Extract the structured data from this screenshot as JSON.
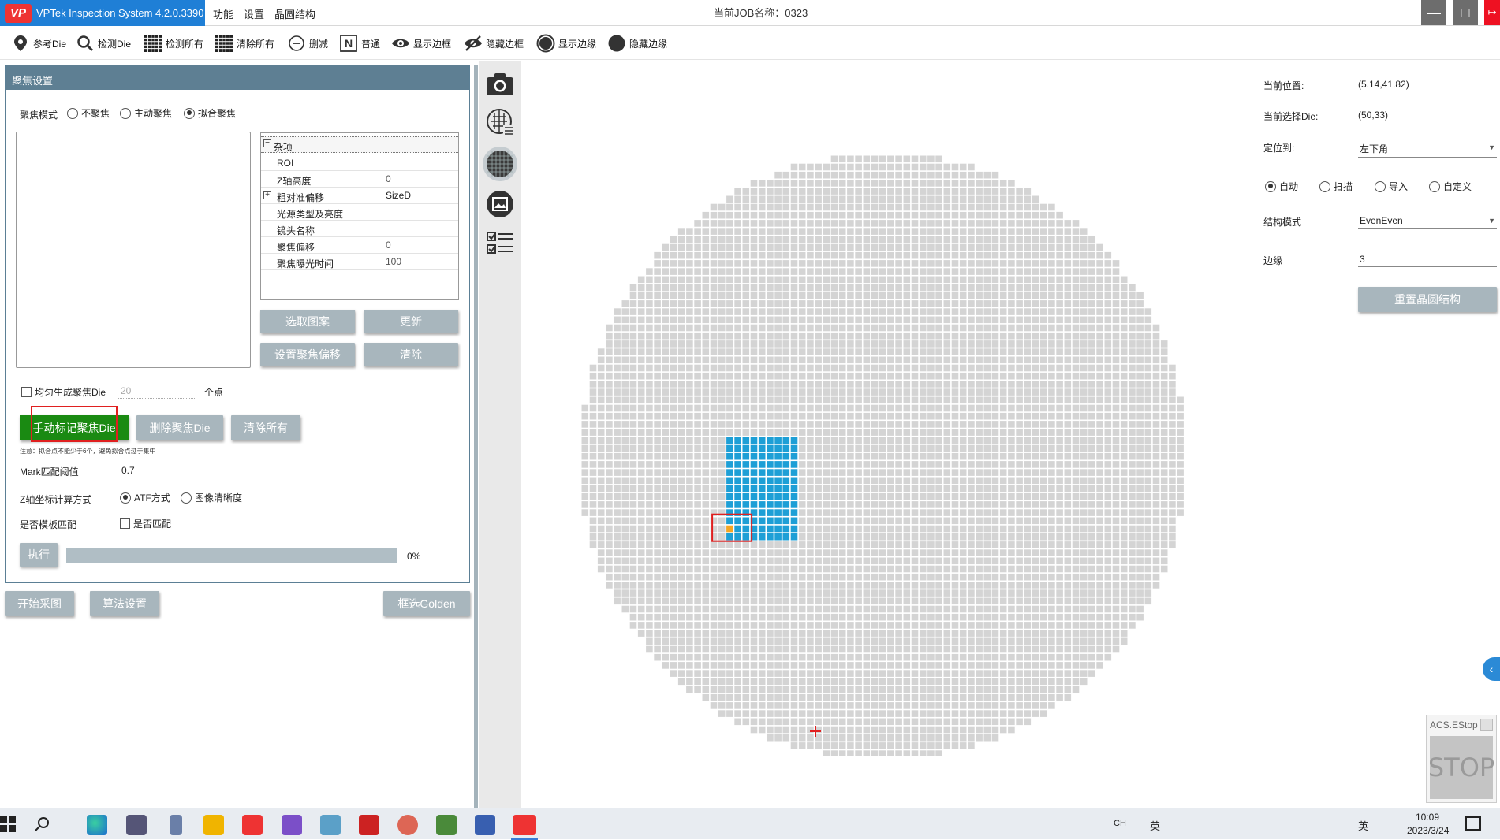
{
  "app": {
    "logo": "VP",
    "title": "VPTek Inspection System 4.2.0.3390",
    "menu": [
      "功能",
      "设置",
      "晶圆结构"
    ],
    "job_label": "当前JOB名称：0323"
  },
  "toolbar": [
    {
      "icon": "pin-icon",
      "label": "参考Die"
    },
    {
      "icon": "magnifier-icon",
      "label": "检测Die"
    },
    {
      "icon": "grid-icon",
      "label": "检测所有"
    },
    {
      "icon": "grid-icon",
      "label": "清除所有"
    },
    {
      "icon": "minus-circle-icon",
      "label": "删减"
    },
    {
      "icon": "n-box-icon",
      "label": "普通"
    },
    {
      "icon": "eye-icon",
      "label": "显示边框"
    },
    {
      "icon": "eye-slash-icon",
      "label": "隐藏边框"
    },
    {
      "icon": "circle-ring-icon",
      "label": "显示边缘"
    },
    {
      "icon": "circle-filled-icon",
      "label": "隐藏边缘"
    }
  ],
  "focus_panel": {
    "header": "聚焦设置",
    "mode_label": "聚焦模式",
    "modes": [
      "不聚焦",
      "主动聚焦",
      "拟合聚焦"
    ],
    "mode_selected": 2,
    "property_group": "杂项",
    "properties": [
      {
        "name": "ROI",
        "value": "",
        "expand": false
      },
      {
        "name": "Z轴高度",
        "value": "0",
        "expand": false
      },
      {
        "name": "粗对准偏移",
        "value": "SizeD",
        "expand": true
      },
      {
        "name": "光源类型及亮度",
        "value": "",
        "expand": false
      },
      {
        "name": "镜头名称",
        "value": "",
        "expand": false
      },
      {
        "name": "聚焦偏移",
        "value": "0",
        "expand": false
      },
      {
        "name": "聚焦曝光时间",
        "value": "100",
        "expand": false
      }
    ],
    "btn_select_pattern": "选取图案",
    "btn_update": "更新",
    "btn_set_offset": "设置聚焦偏移",
    "btn_clear": "清除",
    "uniform_label": "均匀生成聚焦Die",
    "uniform_count": "20",
    "uniform_unit": "个点",
    "btn_manual_mark": "手动标记聚焦Die",
    "btn_delete_focus": "删除聚焦Die",
    "btn_clear_all": "清除所有",
    "note": "注意：拟合点不能少于6个，避免拟合点过于集中",
    "mark_threshold_label": "Mark匹配阈值",
    "mark_threshold_value": "0.7",
    "z_calc_label": "Z轴坐标计算方式",
    "z_calc_options": [
      "ATF方式",
      "图像清晰度"
    ],
    "z_calc_selected": 0,
    "template_label": "是否模板匹配",
    "template_check_label": "是否匹配",
    "btn_execute": "执行",
    "progress": 0,
    "progress_text": "0%"
  },
  "bottom_buttons": {
    "start": "开始采图",
    "algo": "算法设置",
    "golden": "框选Golden"
  },
  "right_panel": {
    "pos_label": "当前位置:",
    "pos_value": "(5.14,41.82)",
    "die_label": "当前选择Die:",
    "die_value": "(50,33)",
    "locate_label": "定位到:",
    "locate_value": "左下角",
    "scan_modes": [
      "自动",
      "扫描",
      "导入",
      "自定义"
    ],
    "scan_selected": 0,
    "struct_label": "结构模式",
    "struct_value": "EvenEven",
    "edge_label": "边缘",
    "edge_value": "3",
    "btn_reset": "重置晶圆结构"
  },
  "estop": {
    "label": "ACS.EStop",
    "stop": "STOP"
  },
  "taskbar": {
    "tray": [
      "CH",
      "英",
      "英"
    ],
    "time": "10:09",
    "date": "2023/3/24"
  },
  "colors": {
    "die_gray": "#d4d4d4",
    "die_blue": "#1d9fd6",
    "die_orange": "#f5a623",
    "marker_red": "#e02020",
    "green_button": "#1a8a12",
    "header": "#5e7f93"
  },
  "wafer": {
    "die_rows": 75,
    "die_cols": 75,
    "selected_block": {
      "col_start": 18,
      "col_end": 26,
      "row_start": 35,
      "row_end": 47
    },
    "selected_die": {
      "col": 18,
      "row": 46
    }
  }
}
